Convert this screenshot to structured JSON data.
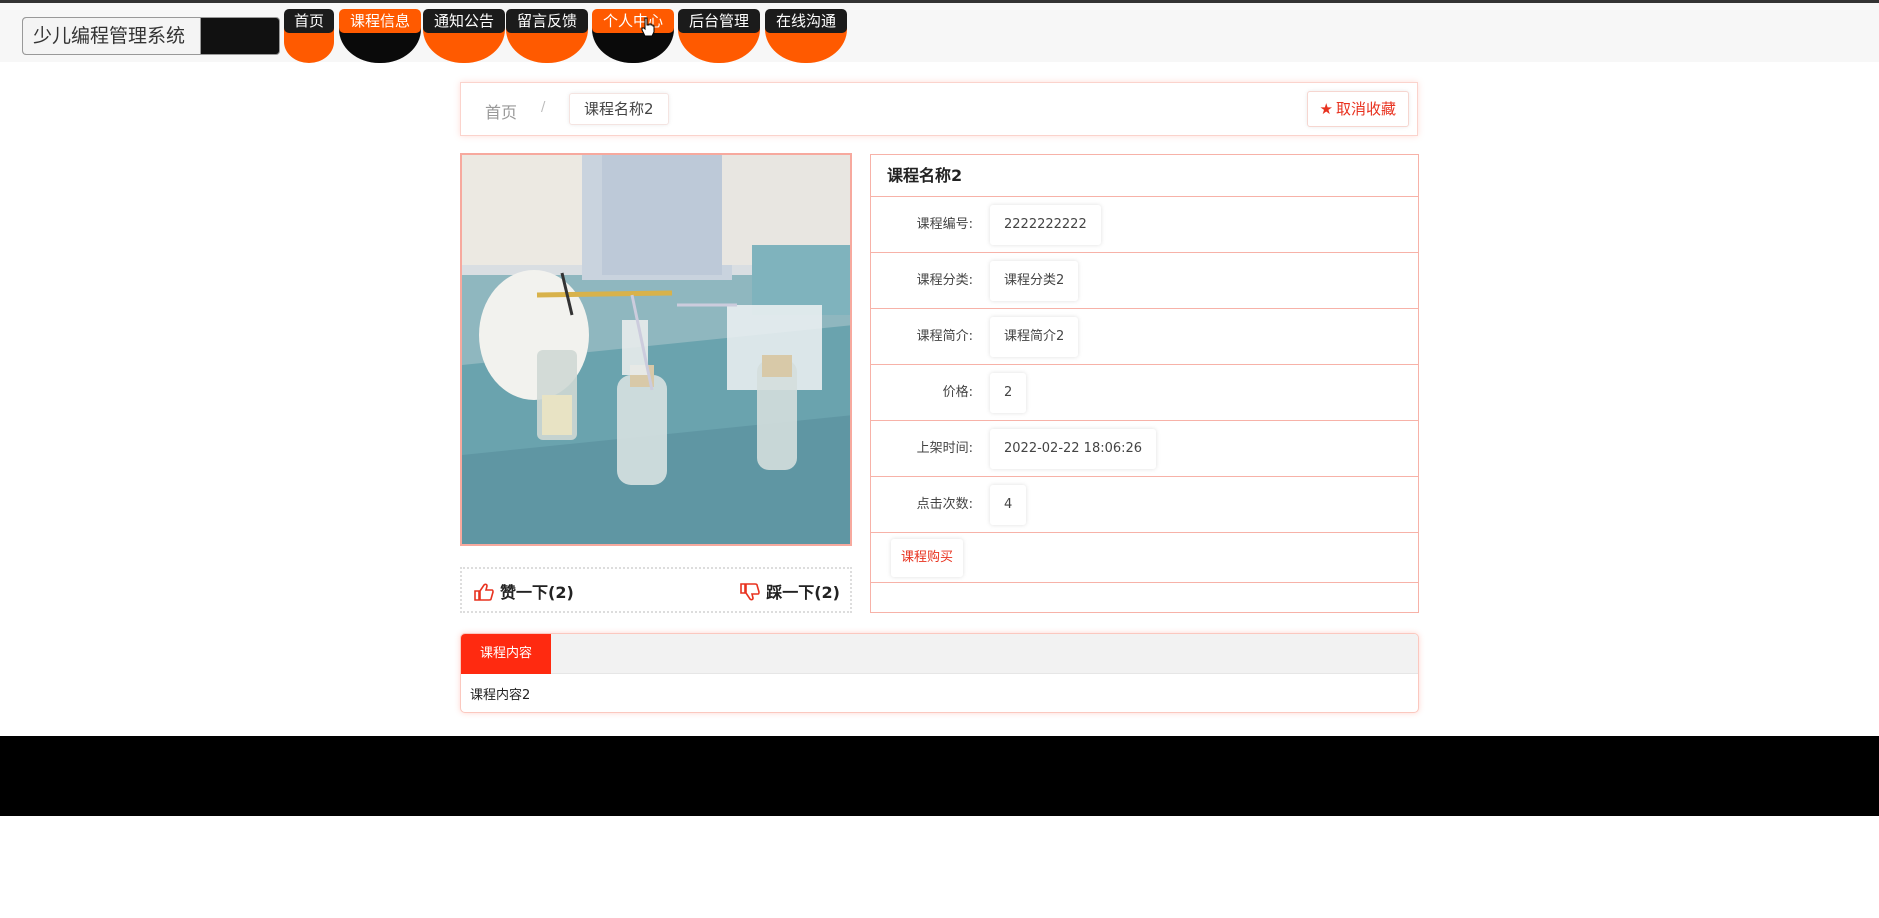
{
  "brand": {
    "title": "少儿编程管理系统"
  },
  "nav": {
    "items": [
      {
        "label": "首页",
        "cap": "dark",
        "bowl": "orange"
      },
      {
        "label": "课程信息",
        "cap": "orange",
        "bowl": "black"
      },
      {
        "label": "通知公告",
        "cap": "dark",
        "bowl": "orange"
      },
      {
        "label": "留言反馈",
        "cap": "dark",
        "bowl": "orange"
      },
      {
        "label": "个人中心",
        "cap": "orange",
        "bowl": "black"
      },
      {
        "label": "后台管理",
        "cap": "dark",
        "bowl": "orange"
      },
      {
        "label": "在线沟通",
        "cap": "dark",
        "bowl": "orange"
      }
    ]
  },
  "breadcrumb": {
    "home": "首页",
    "separator": "/",
    "current": "课程名称2"
  },
  "favorite": {
    "label": "取消收藏",
    "icon": "star-icon"
  },
  "votes": {
    "up_label": "赞一下(2)",
    "down_label": "踩一下(2)"
  },
  "detail": {
    "title": "课程名称2",
    "fields": [
      {
        "label": "课程编号:",
        "value": "2222222222"
      },
      {
        "label": "课程分类:",
        "value": "课程分类2"
      },
      {
        "label": "课程简介:",
        "value": "课程简介2"
      },
      {
        "label": "价格:",
        "value": "2"
      },
      {
        "label": "上架时间:",
        "value": "2022-02-22 18:06:26"
      },
      {
        "label": "点击次数:",
        "value": "4"
      }
    ],
    "buy_label": "课程购买"
  },
  "content": {
    "tab_label": "课程内容",
    "body": "课程内容2"
  },
  "colors": {
    "accent": "#ff5a00",
    "red": "#ff2a10",
    "border": "#f7b2a8"
  }
}
